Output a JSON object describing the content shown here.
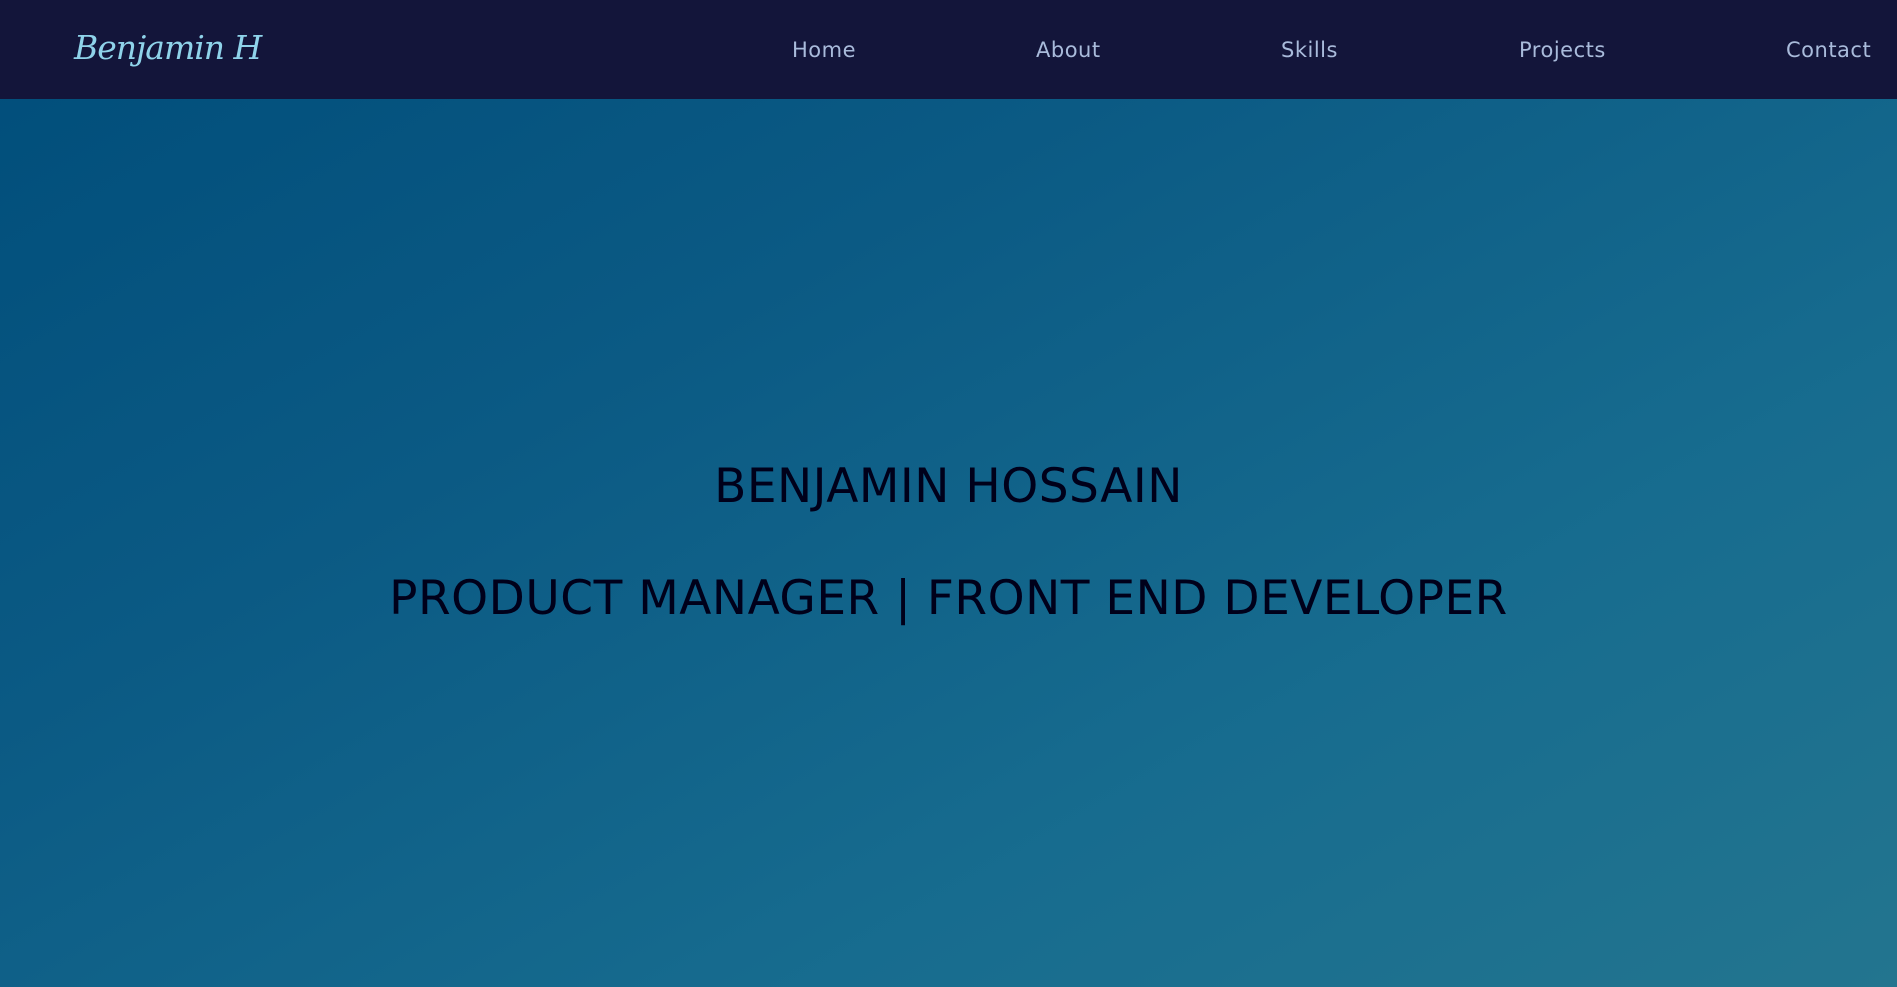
{
  "colors": {
    "navbar_background": "#13153a",
    "logo": "#8fd3ea",
    "nav_link": "#a9bbdb",
    "hero_text": "#00001a",
    "hero_gradient_start": "#004d7a",
    "hero_gradient_end": "#23758f"
  },
  "navbar": {
    "logo_text": "Benjamin H",
    "links": [
      {
        "label": "Home"
      },
      {
        "label": "About"
      },
      {
        "label": "Skills"
      },
      {
        "label": "Projects"
      },
      {
        "label": "Contact"
      }
    ]
  },
  "hero": {
    "name": "BENJAMIN HOSSAIN",
    "role": "PRODUCT MANAGER | FRONT END DEVELOPER"
  }
}
